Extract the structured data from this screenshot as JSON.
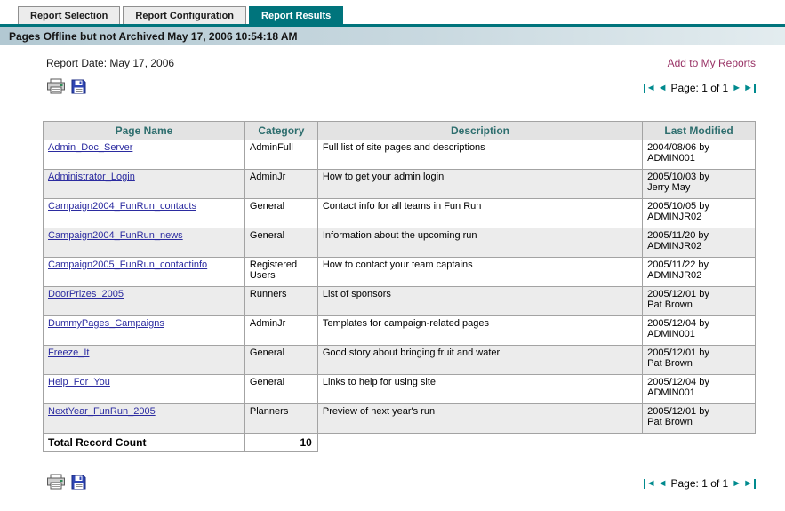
{
  "tabs": [
    {
      "label": "Report Selection"
    },
    {
      "label": "Report Configuration"
    },
    {
      "label": "Report Results"
    }
  ],
  "title_bar": {
    "text": "Pages Offline but not Archived May 17, 2006 10:54:18 AM"
  },
  "toolbar": {
    "report_date": "Report Date: May 17, 2006",
    "add_to_my_reports": "Add to My Reports",
    "pagination_label": "Page: 1 of 1",
    "first_arrow": "◄",
    "prev_arrow": "◄",
    "next_arrow": "►",
    "last_arrow": "►"
  },
  "table": {
    "columns": [
      "Page Name",
      "Category",
      "Description",
      "Last Modified"
    ],
    "rows": [
      {
        "page_name": "Admin_Doc_Server",
        "category": "AdminFull",
        "description": "Full list of site pages and descriptions",
        "last_modified": "2004/08/06 by\nADMIN001"
      },
      {
        "page_name": "Administrator_Login",
        "category": "AdminJr",
        "description": "How to get your admin login",
        "last_modified": "2005/10/03 by\nJerry May"
      },
      {
        "page_name": "Campaign2004_FunRun_contacts",
        "category": "General",
        "description": "Contact info for all teams in Fun Run",
        "last_modified": "2005/10/05 by\nADMINJR02"
      },
      {
        "page_name": "Campaign2004_FunRun_news",
        "category": "General",
        "description": "Information about the upcoming run",
        "last_modified": "2005/11/20 by\nADMINJR02"
      },
      {
        "page_name": "Campaign2005_FunRun_contactinfo",
        "category": "Registered Users",
        "description": "How to contact your team captains",
        "last_modified": "2005/11/22 by\nADMINJR02"
      },
      {
        "page_name": "DoorPrizes_2005",
        "category": "Runners",
        "description": "List of sponsors",
        "last_modified": "2005/12/01 by\nPat Brown"
      },
      {
        "page_name": "DummyPages_Campaigns",
        "category": "AdminJr",
        "description": "Templates for campaign-related pages",
        "last_modified": "2005/12/04 by\nADMIN001"
      },
      {
        "page_name": "Freeze_It",
        "category": "General",
        "description": "Good story about bringing fruit and water",
        "last_modified": "2005/12/01 by\nPat Brown"
      },
      {
        "page_name": "Help_For_You",
        "category": "General",
        "description": "Links to help for using site",
        "last_modified": "2005/12/04 by\nADMIN001"
      },
      {
        "page_name": "NextYear_FunRun_2005",
        "category": "Planners",
        "description": "Preview of next year's run",
        "last_modified": "2005/12/01 by\nPat Brown"
      }
    ],
    "footer_label": "Total Record Count",
    "footer_value": "10"
  },
  "colors": {
    "teal": "#00747C",
    "pager": "#008A8E",
    "page_link": "#2B2BA0",
    "add_link": "#993366",
    "header_text": "#2E6E6E"
  }
}
